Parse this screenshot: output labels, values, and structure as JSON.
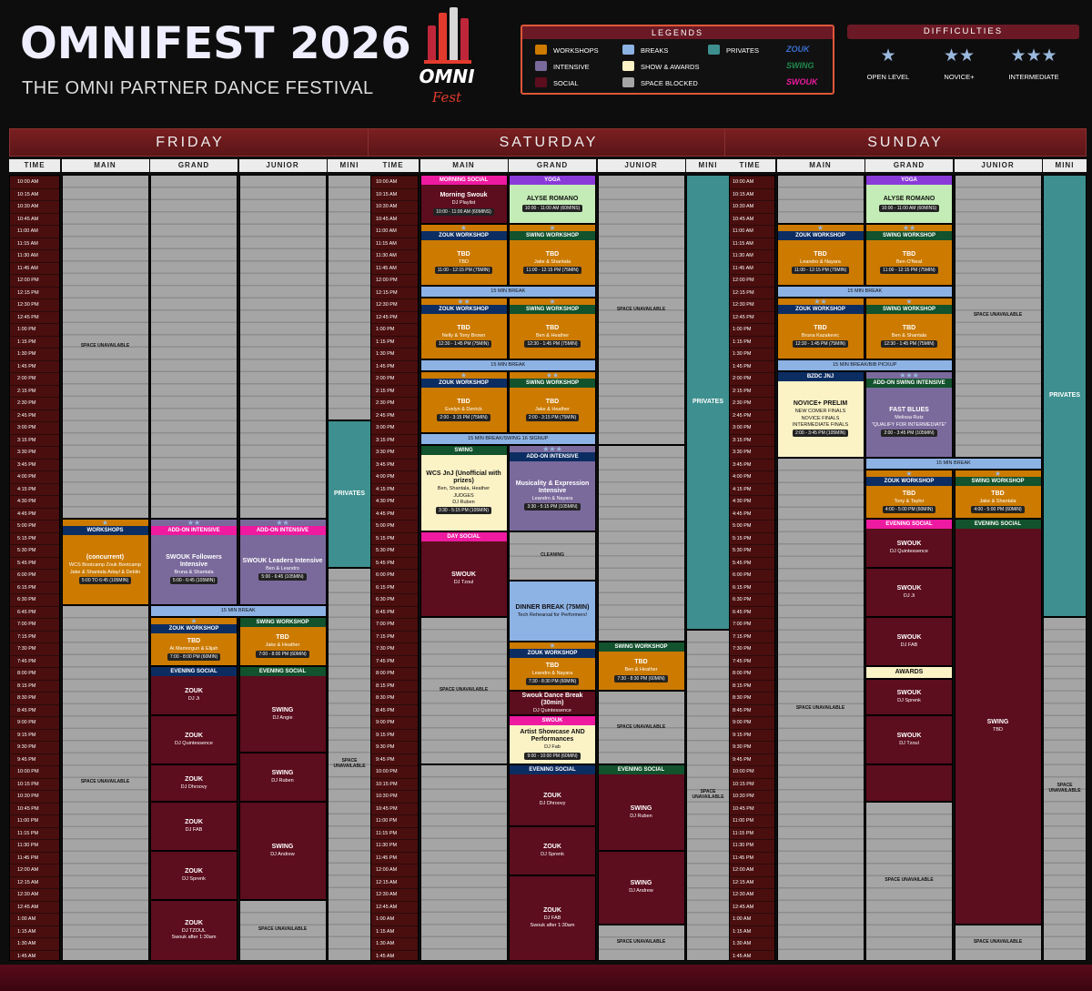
{
  "header": {
    "title": "OMNIFEST 2026",
    "subtitle": "THE OMNI PARTNER DANCE FESTIVAL",
    "logo_text": "OMNI",
    "logo_sub": "Fest"
  },
  "legend": {
    "title": "LEGENDS",
    "items": [
      {
        "label": "WORKSHOPS",
        "color": "#cc7a00"
      },
      {
        "label": "INTENSIVE",
        "color": "#7a6a9c"
      },
      {
        "label": "SOCIAL",
        "color": "#5c0d1e"
      },
      {
        "label": "BREAKS",
        "color": "#8db2e4"
      },
      {
        "label": "SHOW & AWARDS",
        "color": "#fbf2c6"
      },
      {
        "label": "SPACE BLOCKED",
        "color": "#a5a5a5"
      },
      {
        "label": "PRIVATES",
        "color": "#3e8f8f"
      }
    ],
    "styles": [
      {
        "label": "ZOUK",
        "color": "#3a6fd0"
      },
      {
        "label": "SWING",
        "color": "#1f8a4c"
      },
      {
        "label": "SWOUK",
        "color": "#ee1aa0"
      }
    ]
  },
  "difficulties": {
    "title": "DIFFICULTIES",
    "levels": [
      {
        "stars": "★",
        "label": "OPEN LEVEL"
      },
      {
        "stars": "★★",
        "label": "NOVICE+"
      },
      {
        "stars": "★★★",
        "label": "INTERMEDIATE"
      }
    ]
  },
  "columns": [
    "TIME",
    "MAIN",
    "GRAND",
    "JUNIOR",
    "MINI"
  ],
  "days": [
    "FRIDAY",
    "SATURDAY",
    "SUNDAY"
  ],
  "times": [
    "10:00 AM",
    "10:15 AM",
    "10:30 AM",
    "10:45 AM",
    "11:00 AM",
    "11:15 AM",
    "11:30 AM",
    "11:45 AM",
    "12:00 PM",
    "12:15 PM",
    "12:30 PM",
    "12:45 PM",
    "1:00 PM",
    "1:15 PM",
    "1:30 PM",
    "1:45 PM",
    "2:00 PM",
    "2:15 PM",
    "2:30 PM",
    "2:45 PM",
    "3:00 PM",
    "3:15 PM",
    "3:30 PM",
    "3:45 PM",
    "4:00 PM",
    "4:15 PM",
    "4:30 PM",
    "4:45 PM",
    "5:00 PM",
    "5:15 PM",
    "5:30 PM",
    "5:45 PM",
    "6:00 PM",
    "6:15 PM",
    "6:30 PM",
    "6:45 PM",
    "7:00 PM",
    "7:15 PM",
    "7:30 PM",
    "7:45 PM",
    "8:00 PM",
    "8:15 PM",
    "8:30 PM",
    "8:45 PM",
    "9:00 PM",
    "9:15 PM",
    "9:30 PM",
    "9:45 PM",
    "10:00 PM",
    "10:15 PM",
    "10:30 PM",
    "10:45 PM",
    "11:00 PM",
    "11:15 PM",
    "11:30 PM",
    "11:45 PM",
    "12:00 AM",
    "12:15 AM",
    "12:30 AM",
    "12:45 AM",
    "1:00 AM",
    "1:15 AM",
    "1:30 AM",
    "1:45 AM"
  ],
  "blocks": [
    {
      "day": 0,
      "col": 1,
      "s": 0,
      "e": 28,
      "kind": "gray",
      "lines": [
        "SPACE UNAVAILABLE"
      ]
    },
    {
      "day": 0,
      "col": 2,
      "s": 0,
      "e": 28,
      "kind": "gray",
      "lines": []
    },
    {
      "day": 0,
      "col": 3,
      "s": 0,
      "e": 28,
      "kind": "gray",
      "lines": []
    },
    {
      "day": 0,
      "col": 4,
      "s": 0,
      "e": 20,
      "kind": "gray",
      "lines": []
    },
    {
      "day": 0,
      "col": 4,
      "s": 20,
      "e": 32,
      "kind": "teal",
      "lines": [
        "PRIVATES"
      ]
    },
    {
      "day": 0,
      "col": 4,
      "s": 32,
      "e": 64,
      "kind": "gray",
      "lines": [
        "SPACE UNAVAILABLE"
      ]
    },
    {
      "day": 0,
      "col": 1,
      "s": 28,
      "e": 35,
      "kind": "orange",
      "head": "WORKSHOPS",
      "hstyle": "zhead",
      "stars": "★",
      "lines": [
        "(concurrent)",
        "WCS Bootcamp   Zouk Bootcamp",
        "Jake & Shantala   Adayl & Deblin"
      ],
      "tag": "5:00 TO 6:45 (105MIN)"
    },
    {
      "day": 0,
      "col": 2,
      "s": 28,
      "e": 35,
      "kind": "purple",
      "head": "ADD-ON INTENSIVE",
      "hstyle": "pink",
      "stars": "★★",
      "lines": [
        "SWOUK Followers Intensive",
        "Bruna & Shantala"
      ],
      "tag": "5:00 - 6:45 (105MIN)"
    },
    {
      "day": 0,
      "col": 3,
      "s": 28,
      "e": 35,
      "kind": "purple",
      "head": "ADD-ON INTENSIVE",
      "hstyle": "pink",
      "stars": "★★",
      "lines": [
        "SWOUK Leaders Intensive",
        "Ben & Leandro"
      ],
      "tag": "5:00 - 6:45 (105MIN)"
    },
    {
      "day": 0,
      "col": 1,
      "s": 35,
      "e": 64,
      "kind": "gray",
      "lines": [
        "SPACE UNAVAILABLE"
      ]
    },
    {
      "day": 0,
      "col": 2,
      "s": 35,
      "e": 36,
      "kind": "blue",
      "span": 2,
      "lines": [
        "15 MIN BREAK"
      ]
    },
    {
      "day": 0,
      "col": 2,
      "s": 36,
      "e": 40,
      "kind": "orange",
      "head": "ZOUK WORKSHOP",
      "hstyle": "zhead",
      "stars": "★",
      "lines": [
        "TBD",
        "Ai Mamorgun & Elijah"
      ],
      "tag": "7:00 - 8:00 PM (60MIN)"
    },
    {
      "day": 0,
      "col": 3,
      "s": 36,
      "e": 40,
      "kind": "orange",
      "head": "SWING WORKSHOP",
      "hstyle": "shead",
      "lines": [
        "TBD",
        "Jake & Heather"
      ],
      "tag": "7:00 - 8:00 PM (60MIN)"
    },
    {
      "day": 0,
      "col": 2,
      "s": 40,
      "e": 44,
      "kind": "maroon",
      "head": "EVENING SOCIAL",
      "hstyle": "zhead",
      "lines": [
        "ZOUK",
        "DJ Ji"
      ]
    },
    {
      "day": 0,
      "col": 2,
      "s": 44,
      "e": 48,
      "kind": "maroon",
      "lines": [
        "ZOUK",
        "DJ Quintessence"
      ]
    },
    {
      "day": 0,
      "col": 2,
      "s": 48,
      "e": 51,
      "kind": "maroon",
      "lines": [
        "ZOUK",
        "DJ Dhroovy"
      ]
    },
    {
      "day": 0,
      "col": 2,
      "s": 51,
      "e": 55,
      "kind": "maroon",
      "lines": [
        "ZOUK",
        "DJ FAB"
      ]
    },
    {
      "day": 0,
      "col": 2,
      "s": 55,
      "e": 59,
      "kind": "maroon",
      "lines": [
        "ZOUK",
        "DJ Sprenk"
      ]
    },
    {
      "day": 0,
      "col": 2,
      "s": 59,
      "e": 64,
      "kind": "maroon",
      "lines": [
        "ZOUK",
        "DJ TZOUL",
        "Swouk after 1:30am"
      ]
    },
    {
      "day": 0,
      "col": 3,
      "s": 40,
      "e": 47,
      "kind": "maroon",
      "head": "EVENING SOCIAL",
      "hstyle": "shead",
      "lines": [
        "SWING",
        "DJ Angie"
      ]
    },
    {
      "day": 0,
      "col": 3,
      "s": 47,
      "e": 51,
      "kind": "maroon",
      "lines": [
        "SWING",
        "DJ Ruben"
      ]
    },
    {
      "day": 0,
      "col": 3,
      "s": 51,
      "e": 59,
      "kind": "maroon",
      "lines": [
        "SWING",
        "DJ Andrew"
      ]
    },
    {
      "day": 0,
      "col": 3,
      "s": 59,
      "e": 64,
      "kind": "gray",
      "lines": [
        "SPACE UNAVAILABLE"
      ]
    },
    {
      "day": 1,
      "col": 1,
      "s": 0,
      "e": 4,
      "kind": "maroon",
      "head": "MORNING SOCIAL",
      "hstyle": "pink",
      "lines": [
        "Morning Swouk",
        "DJ Playlist"
      ],
      "tag": "10:00 - 11:00 AM (60MINS)"
    },
    {
      "day": 1,
      "col": 2,
      "s": 0,
      "e": 4,
      "kind": "green",
      "head": "YOGA",
      "hstyle": "purplehead",
      "lines": [
        "ALYSE ROMANO"
      ],
      "tag": "10:00 - 11:00 AM (60MINS)"
    },
    {
      "day": 1,
      "col": 3,
      "s": 0,
      "e": 22,
      "kind": "gray",
      "lines": [
        "SPACE UNAVAILABLE"
      ]
    },
    {
      "day": 1,
      "col": 4,
      "s": 0,
      "e": 37,
      "kind": "teal",
      "lines": [
        "PRIVATES"
      ]
    },
    {
      "day": 1,
      "col": 4,
      "s": 37,
      "e": 64,
      "kind": "gray",
      "lines": [
        "SPACE UNAVAILABLE"
      ]
    },
    {
      "day": 1,
      "col": 1,
      "s": 4,
      "e": 9,
      "kind": "orange",
      "head": "ZOUK WORKSHOP",
      "hstyle": "zhead",
      "stars": "★",
      "lines": [
        "TBD",
        "TBD"
      ],
      "tag": "11:00 - 12:15 PM (75MIN)"
    },
    {
      "day": 1,
      "col": 2,
      "s": 4,
      "e": 9,
      "kind": "orange",
      "head": "SWING WORKSHOP",
      "hstyle": "shead",
      "stars": "★",
      "lines": [
        "TBD",
        "Jake & Shantala"
      ],
      "tag": "11:00 - 12:15 PM (75MIN)"
    },
    {
      "day": 1,
      "col": 1,
      "s": 9,
      "e": 10,
      "kind": "blue",
      "span": 2,
      "lines": [
        "15 MIN BREAK"
      ]
    },
    {
      "day": 1,
      "col": 1,
      "s": 10,
      "e": 15,
      "kind": "orange",
      "head": "ZOUK WORKSHOP",
      "hstyle": "zhead",
      "stars": "★★",
      "lines": [
        "TBD",
        "Nelly & Tony Brown"
      ],
      "tag": "12:30 - 1:45 PM (75MIN)"
    },
    {
      "day": 1,
      "col": 2,
      "s": 10,
      "e": 15,
      "kind": "orange",
      "head": "SWING WORKSHOP",
      "hstyle": "shead",
      "stars": "★",
      "lines": [
        "TBD",
        "Ben & Heather"
      ],
      "tag": "12:30 - 1:45 PM (75MIN)"
    },
    {
      "day": 1,
      "col": 1,
      "s": 15,
      "e": 16,
      "kind": "blue",
      "span": 2,
      "lines": [
        "15 MIN BREAK"
      ]
    },
    {
      "day": 1,
      "col": 1,
      "s": 16,
      "e": 21,
      "kind": "orange",
      "head": "ZOUK WORKSHOP",
      "hstyle": "zhead",
      "stars": "★",
      "lines": [
        "TBD",
        "Evelyn & Derrick"
      ],
      "tag": "2:00 - 3:15 PM (75MIN)"
    },
    {
      "day": 1,
      "col": 2,
      "s": 16,
      "e": 21,
      "kind": "orange",
      "head": "SWING WORKSHOP",
      "hstyle": "shead",
      "stars": "★★",
      "lines": [
        "TBD",
        "Jake & Heather"
      ],
      "tag": "2:00 - 3:15 PM (75MIN)"
    },
    {
      "day": 1,
      "col": 1,
      "s": 21,
      "e": 22,
      "kind": "blue",
      "span": 2,
      "lines": [
        "15 MIN BREAK/SWING 16 SIGNUP"
      ]
    },
    {
      "day": 1,
      "col": 1,
      "s": 22,
      "e": 29,
      "kind": "cream",
      "head": "SWING",
      "hstyle": "shead",
      "lines": [
        "WCS JnJ (Unofficial with prizes)",
        "Ben, Shantala, Heather",
        "JUDGES",
        "DJ Ruben"
      ],
      "tag": "3:30 - 5:15 PM (105MIN)"
    },
    {
      "day": 1,
      "col": 2,
      "s": 22,
      "e": 29,
      "kind": "purple",
      "head": "ADD-ON INTENSIVE",
      "hstyle": "zhead",
      "stars": "★★★",
      "lines": [
        "Musicality & Expression Intensive",
        "Leandro & Nayara"
      ],
      "tag": "3:30 - 5:15 PM (105MIN)"
    },
    {
      "day": 1,
      "col": 3,
      "s": 22,
      "e": 38,
      "kind": "gray",
      "lines": []
    },
    {
      "day": 1,
      "col": 1,
      "s": 29,
      "e": 36,
      "kind": "maroon",
      "head": "DAY SOCIAL",
      "hstyle": "pink",
      "lines": [
        "SWOUK",
        "DJ Tzoul"
      ]
    },
    {
      "day": 1,
      "col": 1,
      "s": 36,
      "e": 48,
      "kind": "gray",
      "lines": [
        "SPACE UNAVAILABLE"
      ]
    },
    {
      "day": 1,
      "col": 2,
      "s": 29,
      "e": 33,
      "kind": "gray",
      "lines": [
        "CLEANING"
      ]
    },
    {
      "day": 1,
      "col": 2,
      "s": 33,
      "e": 38,
      "kind": "blue",
      "lines": [
        "DINNER BREAK (75MIN)",
        "Tech Rehearsal for Performers!"
      ]
    },
    {
      "day": 1,
      "col": 2,
      "s": 38,
      "e": 42,
      "kind": "orange",
      "head": "ZOUK WORKSHOP",
      "hstyle": "zhead",
      "stars": "★",
      "lines": [
        "TBD",
        "Leandro & Nayara"
      ],
      "tag": "7:30 - 8:30 PM (60MIN)"
    },
    {
      "day": 1,
      "col": 3,
      "s": 38,
      "e": 42,
      "kind": "orange",
      "head": "SWING WORKSHOP",
      "hstyle": "shead",
      "lines": [
        "TBD",
        "Ben & Heather"
      ],
      "tag": "7:30 - 8:30 PM (60MIN)"
    },
    {
      "day": 1,
      "col": 2,
      "s": 42,
      "e": 44,
      "kind": "maroon",
      "lines": [
        "Swouk Dance Break (30min)",
        "DJ Quintessence"
      ]
    },
    {
      "day": 1,
      "col": 3,
      "s": 42,
      "e": 48,
      "kind": "gray",
      "lines": [
        "SPACE UNAVAILABLE"
      ]
    },
    {
      "day": 1,
      "col": 2,
      "s": 44,
      "e": 48,
      "kind": "cream",
      "head": "SWOUK",
      "hstyle": "pink",
      "lines": [
        "Artist Showcase AND Performances",
        "DJ Fab"
      ],
      "tag": "9:00 - 10:00 PM (60MIN)"
    },
    {
      "day": 1,
      "col": 1,
      "s": 48,
      "e": 64,
      "kind": "gray",
      "lines": []
    },
    {
      "day": 1,
      "col": 2,
      "s": 48,
      "e": 53,
      "kind": "maroon",
      "head": "EVENING SOCIAL",
      "hstyle": "zhead",
      "lines": [
        "ZOUK",
        "DJ Dhroovy"
      ]
    },
    {
      "day": 1,
      "col": 2,
      "s": 53,
      "e": 57,
      "kind": "maroon",
      "lines": [
        "ZOUK",
        "DJ Sprenk"
      ]
    },
    {
      "day": 1,
      "col": 2,
      "s": 57,
      "e": 64,
      "kind": "maroon",
      "lines": [
        "ZOUK",
        "DJ FAB",
        "Swouk after 1:30am"
      ]
    },
    {
      "day": 1,
      "col": 3,
      "s": 48,
      "e": 55,
      "kind": "maroon",
      "head": "EVENING SOCIAL",
      "hstyle": "shead",
      "lines": [
        "SWING",
        "DJ Ruben"
      ]
    },
    {
      "day": 1,
      "col": 3,
      "s": 55,
      "e": 61,
      "kind": "maroon",
      "lines": [
        "SWING",
        "DJ Andrew"
      ]
    },
    {
      "day": 1,
      "col": 3,
      "s": 61,
      "e": 64,
      "kind": "gray",
      "lines": [
        "SPACE UNAVAILABLE"
      ]
    },
    {
      "day": 2,
      "col": 1,
      "s": 0,
      "e": 4,
      "kind": "gray",
      "lines": []
    },
    {
      "day": 2,
      "col": 2,
      "s": 0,
      "e": 4,
      "kind": "green",
      "head": "YOGA",
      "hstyle": "purplehead",
      "lines": [
        "ALYSE ROMANO"
      ],
      "tag": "10:00 - 11:00 AM (60MINS)"
    },
    {
      "day": 2,
      "col": 3,
      "s": 0,
      "e": 23,
      "kind": "gray",
      "lines": [
        "SPACE UNAVAILABLE"
      ]
    },
    {
      "day": 2,
      "col": 4,
      "s": 0,
      "e": 36,
      "kind": "teal",
      "lines": [
        "PRIVATES"
      ]
    },
    {
      "day": 2,
      "col": 4,
      "s": 36,
      "e": 64,
      "kind": "gray",
      "lines": [
        "SPACE UNAVAILABLE"
      ]
    },
    {
      "day": 2,
      "col": 1,
      "s": 4,
      "e": 9,
      "kind": "orange",
      "head": "ZOUK WORKSHOP",
      "hstyle": "zhead",
      "stars": "★",
      "lines": [
        "TBD",
        "Leandro & Nayara"
      ],
      "tag": "11:00 - 12:15 PM (75MIN)"
    },
    {
      "day": 2,
      "col": 2,
      "s": 4,
      "e": 9,
      "kind": "orange",
      "head": "SWING WORKSHOP",
      "hstyle": "shead",
      "stars": "★★",
      "lines": [
        "TBD",
        "Ben O'Neal"
      ],
      "tag": "11:00 - 12:15 PM (75MIN)"
    },
    {
      "day": 2,
      "col": 1,
      "s": 9,
      "e": 10,
      "kind": "blue",
      "span": 2,
      "lines": [
        "15 MIN BREAK"
      ]
    },
    {
      "day": 2,
      "col": 1,
      "s": 10,
      "e": 15,
      "kind": "orange",
      "head": "ZOUK WORKSHOP",
      "hstyle": "zhead",
      "stars": "★★",
      "lines": [
        "TBD",
        "Bruna Kazakevic"
      ],
      "tag": "12:30 - 1:45 PM (75MIN)"
    },
    {
      "day": 2,
      "col": 2,
      "s": 10,
      "e": 15,
      "kind": "orange",
      "head": "SWING WORKSHOP",
      "hstyle": "shead",
      "stars": "★",
      "lines": [
        "TBD",
        "Ben & Shantala"
      ],
      "tag": "12:30 - 1:45 PM (75MIN)"
    },
    {
      "day": 2,
      "col": 1,
      "s": 15,
      "e": 16,
      "kind": "blue",
      "span": 2,
      "lines": [
        "15 MIN BREAK/BIB PICKUP"
      ]
    },
    {
      "day": 2,
      "col": 1,
      "s": 16,
      "e": 23,
      "kind": "cream",
      "head": "BZDC JNJ",
      "hstyle": "zhead",
      "lines": [
        "NOVICE+ PRELIM",
        "NEW COMER FINALS",
        "NOVICE FINALS",
        "INTERMEDIATE FINALS"
      ],
      "tag": "2:00 - 3:45 PM (105MIN)"
    },
    {
      "day": 2,
      "col": 2,
      "s": 16,
      "e": 23,
      "kind": "purple",
      "head": "ADD-ON SWING INTENSIVE",
      "hstyle": "shead",
      "stars": "★★★",
      "lines": [
        "FAST BLUES",
        "Melissa Rutz",
        "\"QUALIFY FOR INTERMEDIATE\""
      ],
      "tag": "2:00 - 3:45 PM (105MIN)"
    },
    {
      "day": 2,
      "col": 1,
      "s": 23,
      "e": 64,
      "kind": "gray",
      "lines": [
        "SPACE UNAVAILABLE"
      ]
    },
    {
      "day": 2,
      "col": 2,
      "s": 23,
      "e": 24,
      "kind": "blue",
      "span": 2,
      "lines": [
        "15 MIN BREAK"
      ]
    },
    {
      "day": 2,
      "col": 2,
      "s": 24,
      "e": 28,
      "kind": "orange",
      "head": "ZOUK WORKSHOP",
      "hstyle": "zhead",
      "stars": "★",
      "lines": [
        "TBD",
        "Tony & Taylor"
      ],
      "tag": "4:00 - 5:00 PM (60MIN)"
    },
    {
      "day": 2,
      "col": 3,
      "s": 24,
      "e": 28,
      "kind": "orange",
      "head": "SWING WORKSHOP",
      "hstyle": "shead",
      "stars": "★",
      "lines": [
        "TBD",
        "Jake & Shantala"
      ],
      "tag": "4:00 - 5:00 PM (60MIN)"
    },
    {
      "day": 2,
      "col": 2,
      "s": 28,
      "e": 32,
      "kind": "maroon",
      "head": "EVENING SOCIAL",
      "hstyle": "pink",
      "lines": [
        "SWOUK",
        "DJ Quintessence"
      ]
    },
    {
      "day": 2,
      "col": 2,
      "s": 32,
      "e": 36,
      "kind": "maroon",
      "lines": [
        "SWOUK",
        "DJ Ji"
      ]
    },
    {
      "day": 2,
      "col": 2,
      "s": 36,
      "e": 40,
      "kind": "maroon",
      "lines": [
        "SWOUK",
        "DJ FAB"
      ]
    },
    {
      "day": 2,
      "col": 2,
      "s": 40,
      "e": 41,
      "kind": "cream",
      "lines": [
        "AWARDS"
      ]
    },
    {
      "day": 2,
      "col": 2,
      "s": 41,
      "e": 44,
      "kind": "maroon",
      "lines": [
        "SWOUK",
        "DJ Sprenk"
      ]
    },
    {
      "day": 2,
      "col": 2,
      "s": 44,
      "e": 48,
      "kind": "maroon",
      "lines": [
        "SWOUK",
        "DJ Tzoul"
      ]
    },
    {
      "day": 2,
      "col": 2,
      "s": 48,
      "e": 51,
      "kind": "maroon",
      "lines": []
    },
    {
      "day": 2,
      "col": 2,
      "s": 51,
      "e": 64,
      "kind": "gray",
      "lines": [
        "SPACE UNAVAILABLE"
      ]
    },
    {
      "day": 2,
      "col": 3,
      "s": 28,
      "e": 61,
      "kind": "maroon",
      "head": "EVENING SOCIAL",
      "hstyle": "shead",
      "lines": [
        "SWING",
        "TBD"
      ]
    },
    {
      "day": 2,
      "col": 3,
      "s": 61,
      "e": 64,
      "kind": "gray",
      "lines": [
        "SPACE UNAVAILABLE"
      ]
    }
  ]
}
